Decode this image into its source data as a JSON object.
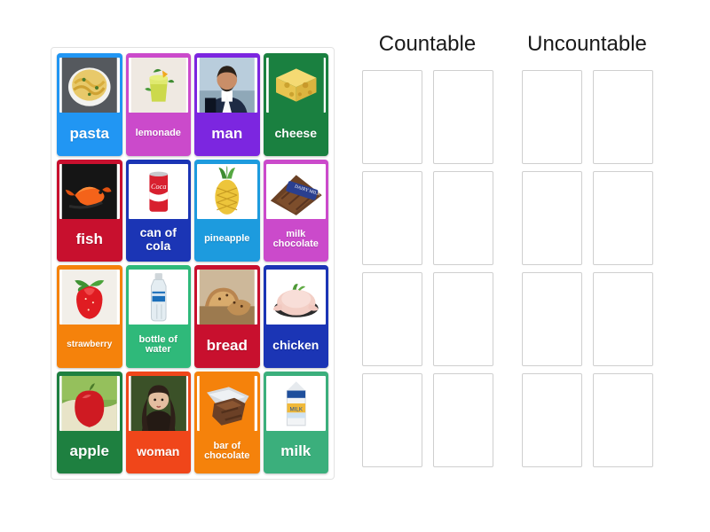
{
  "tray": {
    "name": "word-card-tray",
    "cards": [
      {
        "label": "pasta",
        "color": "#2196F3",
        "icon": "pasta-bowl-icon",
        "size": "lg"
      },
      {
        "label": "lemonade",
        "color": "#CB4ACB",
        "icon": "lemonade-glass-icon",
        "size": "sm"
      },
      {
        "label": "man",
        "color": "#7C26E0",
        "icon": "man-portrait-icon",
        "size": "lg"
      },
      {
        "label": "cheese",
        "color": "#1A8040",
        "icon": "cheese-block-icon",
        "size": "md"
      },
      {
        "label": "fish",
        "color": "#C8102E",
        "icon": "goldfish-icon",
        "size": "lg"
      },
      {
        "label": "can of cola",
        "color": "#1B35B5",
        "icon": "cola-can-icon",
        "size": "md"
      },
      {
        "label": "pineapple",
        "color": "#1D9BDE",
        "icon": "pineapple-icon",
        "size": "sm"
      },
      {
        "label": "milk chocolate",
        "color": "#CB4ACB",
        "icon": "chocolate-bar-icon",
        "size": "sm"
      },
      {
        "label": "strawberry",
        "color": "#F5820B",
        "icon": "strawberry-icon",
        "size": "xs"
      },
      {
        "label": "bottle of water",
        "color": "#2FB97A",
        "icon": "water-bottle-icon",
        "size": "sm"
      },
      {
        "label": "bread",
        "color": "#C8102E",
        "icon": "bread-loaf-icon",
        "size": "lg"
      },
      {
        "label": "chicken",
        "color": "#1B35B5",
        "icon": "raw-chicken-icon",
        "size": "md"
      },
      {
        "label": "apple",
        "color": "#1E8040",
        "icon": "apple-icon",
        "size": "lg"
      },
      {
        "label": "woman",
        "color": "#F0461A",
        "icon": "woman-portrait-icon",
        "size": "md"
      },
      {
        "label": "bar of chocolate",
        "color": "#F5820B",
        "icon": "chocolate-bar-foil-icon",
        "size": "sm"
      },
      {
        "label": "milk",
        "color": "#3BAF7C",
        "icon": "milk-carton-icon",
        "size": "lg"
      }
    ]
  },
  "columns": [
    {
      "title": "Countable",
      "slot_count": 8
    },
    {
      "title": "Uncountable",
      "slot_count": 8
    }
  ],
  "colors": {
    "page_background": "#FFFFFF",
    "tray_border": "#E2E2E2",
    "slot_border": "#CFCFCF",
    "title_text": "#1A1A1A",
    "card_label_text": "#FFFFFF"
  }
}
